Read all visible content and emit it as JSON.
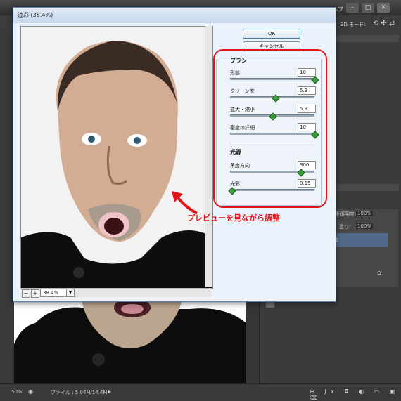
{
  "photoshop": {
    "window_controls": [
      "–",
      "□",
      "✕"
    ],
    "options_bar": {
      "mode_label": "3D モード:"
    },
    "title_fragment": "ルプ",
    "status": {
      "zoom": "50%",
      "file_info": "ファイル : 5.04M/14.4M"
    },
    "layers": {
      "opacity_label": "不透明度:",
      "opacity_value": "100%",
      "fill_label": "塗り:",
      "fill_value": "100%",
      "layer_number": "2"
    }
  },
  "dialog": {
    "title": "油彩 (38.4%)",
    "ok_label": "OK",
    "cancel_label": "キャンセル",
    "zoom_value": "38.4%",
    "brush": {
      "section_title": "ブラシ",
      "params": [
        {
          "label": "形態",
          "value": "10",
          "level": 1.0
        },
        {
          "label": "クリーン度",
          "value": "5.3",
          "level": 0.53
        },
        {
          "label": "拡大・縮小",
          "value": "5.3",
          "level": 0.5
        },
        {
          "label": "密度の詳細",
          "value": "10",
          "level": 1.0
        }
      ]
    },
    "lighting": {
      "section_title": "光源",
      "params": [
        {
          "label": "角度方向",
          "value": "300",
          "level": 0.83
        },
        {
          "label": "光彩",
          "value": "0.15",
          "level": 0.02
        }
      ]
    }
  },
  "annotation": {
    "text": "プレビューを見ながら調整",
    "color": "#e2141a"
  },
  "colors": {
    "accent_red": "#e2141a",
    "slider_green": "#3b9f3b",
    "dialog_frame": "#5a7fa8"
  }
}
